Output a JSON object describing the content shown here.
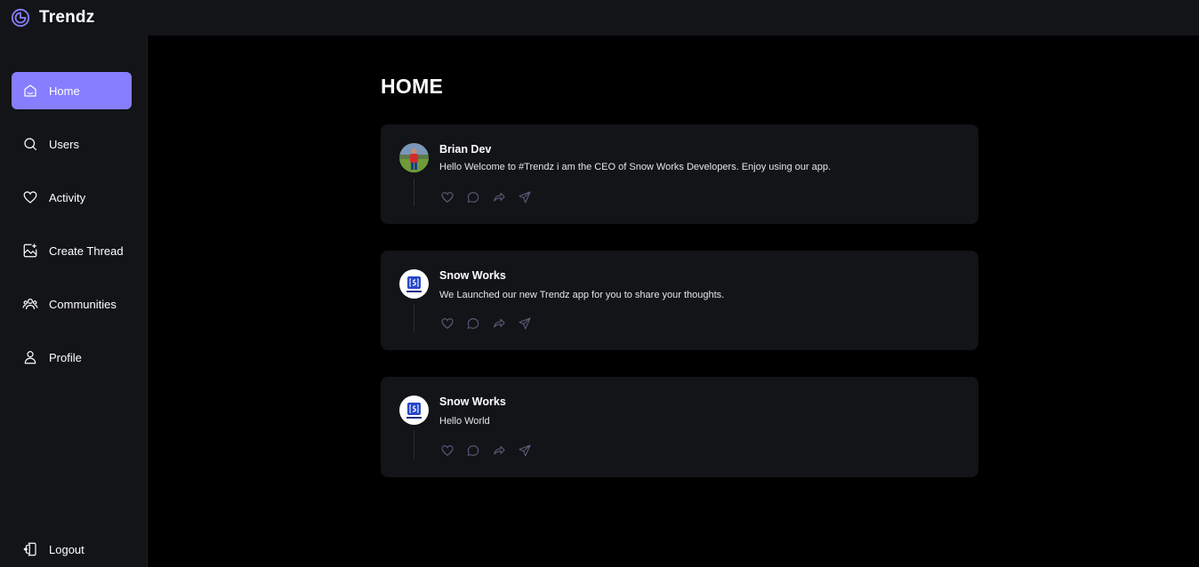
{
  "app": {
    "name": "Trendz"
  },
  "sidebar": {
    "items": [
      {
        "label": "Home",
        "icon": "home-icon",
        "active": true
      },
      {
        "label": "Users",
        "icon": "search-icon",
        "active": false
      },
      {
        "label": "Activity",
        "icon": "heart-icon",
        "active": false
      },
      {
        "label": "Create Thread",
        "icon": "create-thread-icon",
        "active": false
      },
      {
        "label": "Communities",
        "icon": "communities-icon",
        "active": false
      },
      {
        "label": "Profile",
        "icon": "user-icon",
        "active": false
      }
    ],
    "logout_label": "Logout"
  },
  "main": {
    "title": "HOME",
    "threads": [
      {
        "author": "Brian Dev",
        "content": "Hello Welcome to #Trendz i am the CEO of Snow Works Developers. Enjoy using our app."
      },
      {
        "author": "Snow Works",
        "content": "We Launched our new Trendz app for you to share your thoughts."
      },
      {
        "author": "Snow Works",
        "content": "Hello World"
      }
    ]
  },
  "colors": {
    "accent": "#877eff",
    "panel": "#121417",
    "background": "#000000"
  }
}
